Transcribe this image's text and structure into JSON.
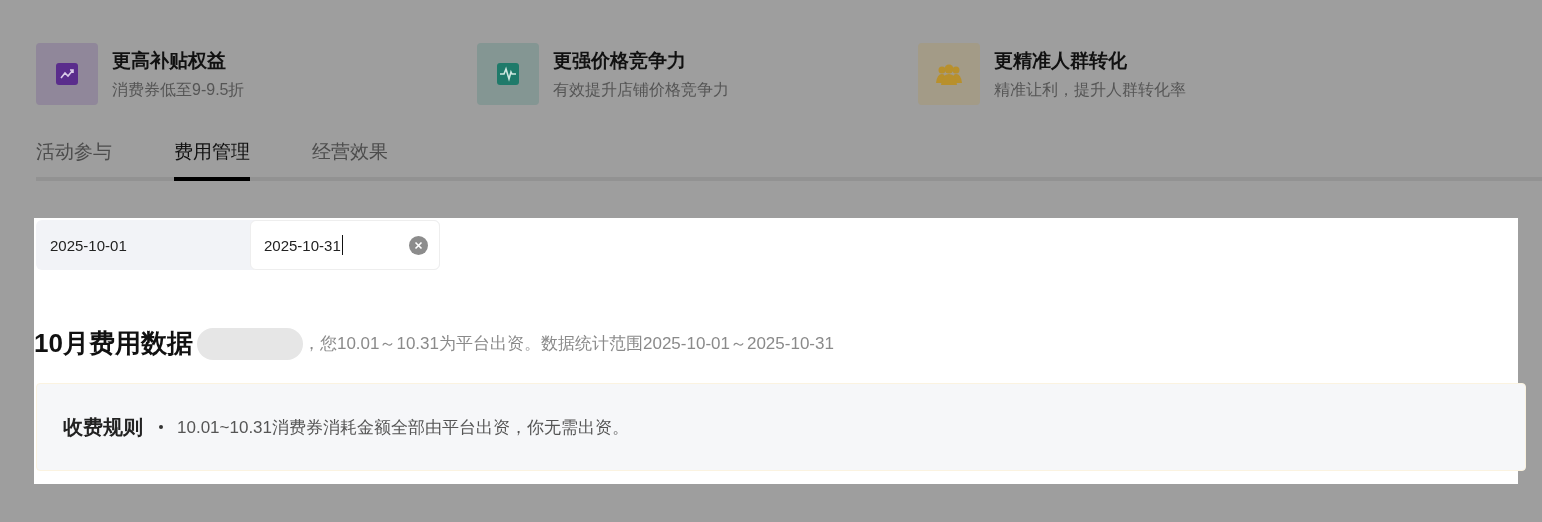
{
  "benefits": [
    {
      "kind": "trend",
      "title": "更高补贴权益",
      "subtitle": "消费券低至9-9.5折",
      "color": "#5a2d8c"
    },
    {
      "kind": "pulse",
      "title": "更强价格竞争力",
      "subtitle": "有效提升店铺价格竞争力",
      "color": "#1f7a6a"
    },
    {
      "kind": "people",
      "title": "更精准人群转化",
      "subtitle": "精准让利，提升人群转化率",
      "color": "#b8902c"
    }
  ],
  "tabs": [
    {
      "label": "活动参与",
      "selected": false
    },
    {
      "label": "费用管理",
      "selected": true
    },
    {
      "label": "经营效果",
      "selected": false
    }
  ],
  "date_range": {
    "start": "2025-10-01",
    "end": "2025-10-31"
  },
  "summary": {
    "title": "10月费用数据",
    "note": "，您10.01～10.31为平台出资。数据统计范围2025-10-01～2025-10-31"
  },
  "rule": {
    "label": "收费规则",
    "items": [
      "10.01~10.31消费券消耗金额全部由平台出资，你无需出资。"
    ]
  }
}
